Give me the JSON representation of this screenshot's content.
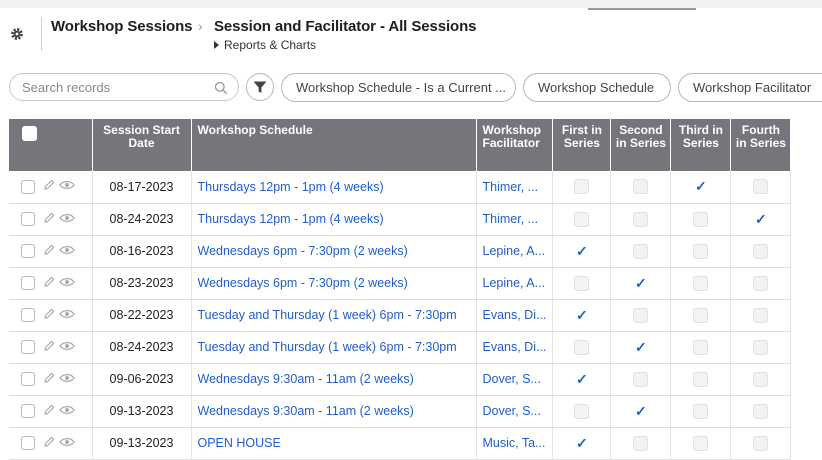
{
  "header": {
    "breadcrumb_root": "Workshop Sessions",
    "breadcrumb_separator": "›",
    "page_title": "Session and Facilitator - All Sessions",
    "sub_link": "Reports & Charts"
  },
  "toolbar": {
    "search_placeholder": "Search records",
    "filters": [
      "Workshop Schedule - Is a Current ...",
      "Workshop Schedule",
      "Workshop Facilitator"
    ]
  },
  "table": {
    "columns": {
      "date": "Session Start Date",
      "schedule": "Workshop Schedule",
      "facilitator": "Workshop Facilitator",
      "first": "First in Series",
      "second": "Second in Series",
      "third": "Third in Series",
      "fourth": "Fourth in Series"
    },
    "rows": [
      {
        "date": "08-17-2023",
        "schedule": "Thursdays 12pm - 1pm (4 weeks)",
        "facilitator": "Thimer, ...",
        "first": false,
        "second": false,
        "third": true,
        "fourth": false
      },
      {
        "date": "08-24-2023",
        "schedule": "Thursdays 12pm - 1pm (4 weeks)",
        "facilitator": "Thimer, ...",
        "first": false,
        "second": false,
        "third": false,
        "fourth": true
      },
      {
        "date": "08-16-2023",
        "schedule": "Wednesdays 6pm - 7:30pm (2 weeks)",
        "facilitator": "Lepine, A...",
        "first": true,
        "second": false,
        "third": false,
        "fourth": false
      },
      {
        "date": "08-23-2023",
        "schedule": "Wednesdays 6pm - 7:30pm (2 weeks)",
        "facilitator": "Lepine, A...",
        "first": false,
        "second": true,
        "third": false,
        "fourth": false
      },
      {
        "date": "08-22-2023",
        "schedule": "Tuesday and Thursday (1 week) 6pm - 7:30pm",
        "facilitator": "Evans, Di...",
        "first": true,
        "second": false,
        "third": false,
        "fourth": false
      },
      {
        "date": "08-24-2023",
        "schedule": "Tuesday and Thursday (1 week) 6pm - 7:30pm",
        "facilitator": "Evans, Di...",
        "first": false,
        "second": true,
        "third": false,
        "fourth": false
      },
      {
        "date": "09-06-2023",
        "schedule": "Wednesdays 9:30am - 11am (2 weeks)",
        "facilitator": "Dover, S...",
        "first": true,
        "second": false,
        "third": false,
        "fourth": false
      },
      {
        "date": "09-13-2023",
        "schedule": "Wednesdays 9:30am - 11am (2 weeks)",
        "facilitator": "Dover, S...",
        "first": false,
        "second": true,
        "third": false,
        "fourth": false
      },
      {
        "date": "09-13-2023",
        "schedule": "OPEN HOUSE",
        "facilitator": "Music, Ta...",
        "first": true,
        "second": false,
        "third": false,
        "fourth": false
      }
    ]
  },
  "icons": {
    "settings": "gear-icon",
    "search": "search-icon",
    "filter": "funnel-icon",
    "edit": "pencil-icon",
    "view": "eye-icon",
    "check": "checkmark-icon"
  },
  "colors": {
    "header_bg": "#76757b",
    "link": "#1f5fc9",
    "check": "#1f5fc9"
  }
}
